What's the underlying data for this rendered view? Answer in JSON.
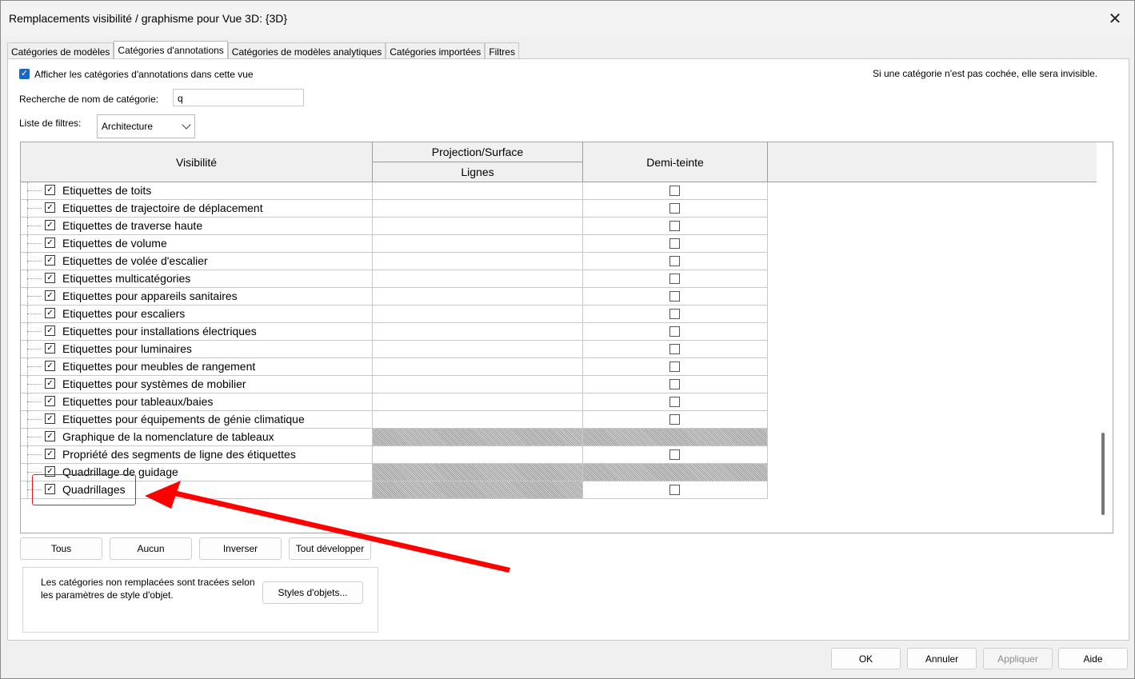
{
  "dialog": {
    "title": "Remplacements visibilité / graphisme pour Vue 3D: {3D}",
    "close_glyph": "✕"
  },
  "tabs": [
    {
      "label": "Catégories de modèles"
    },
    {
      "label": "Catégories d'annotations"
    },
    {
      "label": "Catégories de modèles analytiques"
    },
    {
      "label": "Catégories importées"
    },
    {
      "label": "Filtres"
    }
  ],
  "panel": {
    "show_categories_label": "Afficher les catégories d'annotations dans cette vue",
    "show_categories_checked": true,
    "invisible_hint": "Si une catégorie n'est pas cochée, elle sera invisible.",
    "search_label": "Recherche de nom de catégorie:",
    "search_value": "q",
    "filter_list_label": "Liste de filtres:",
    "filter_list_value": "Architecture"
  },
  "grid": {
    "col_visibility": "Visibilité",
    "col_projection": "Projection/Surface",
    "col_lines": "Lignes",
    "col_halftone": "Demi-teinte",
    "rows": [
      {
        "label": "Etiquettes de toits",
        "checked": true,
        "lines_hatched": false,
        "halftone": "checkbox"
      },
      {
        "label": "Etiquettes de trajectoire de déplacement",
        "checked": true,
        "lines_hatched": false,
        "halftone": "checkbox"
      },
      {
        "label": "Etiquettes de traverse haute",
        "checked": true,
        "lines_hatched": false,
        "halftone": "checkbox"
      },
      {
        "label": "Etiquettes de volume",
        "checked": true,
        "lines_hatched": false,
        "halftone": "checkbox"
      },
      {
        "label": "Etiquettes de volée d'escalier",
        "checked": true,
        "lines_hatched": false,
        "halftone": "checkbox"
      },
      {
        "label": "Etiquettes multicatégories",
        "checked": true,
        "lines_hatched": false,
        "halftone": "checkbox"
      },
      {
        "label": "Etiquettes pour appareils sanitaires",
        "checked": true,
        "lines_hatched": false,
        "halftone": "checkbox"
      },
      {
        "label": "Etiquettes pour escaliers",
        "checked": true,
        "lines_hatched": false,
        "halftone": "checkbox"
      },
      {
        "label": "Etiquettes pour installations électriques",
        "checked": true,
        "lines_hatched": false,
        "halftone": "checkbox"
      },
      {
        "label": "Etiquettes pour luminaires",
        "checked": true,
        "lines_hatched": false,
        "halftone": "checkbox"
      },
      {
        "label": "Etiquettes pour meubles de rangement",
        "checked": true,
        "lines_hatched": false,
        "halftone": "checkbox"
      },
      {
        "label": "Etiquettes pour systèmes de mobilier",
        "checked": true,
        "lines_hatched": false,
        "halftone": "checkbox"
      },
      {
        "label": "Etiquettes pour tableaux/baies",
        "checked": true,
        "lines_hatched": false,
        "halftone": "checkbox"
      },
      {
        "label": "Etiquettes pour équipements de génie climatique",
        "checked": true,
        "lines_hatched": false,
        "halftone": "checkbox"
      },
      {
        "label": "Graphique de la nomenclature de tableaux",
        "checked": true,
        "lines_hatched": true,
        "halftone": "hatched"
      },
      {
        "label": "Propriété des segments de ligne des étiquettes",
        "checked": true,
        "lines_hatched": false,
        "halftone": "checkbox"
      },
      {
        "label": "Quadrillage de guidage",
        "checked": true,
        "lines_hatched": true,
        "halftone": "hatched"
      },
      {
        "label": "Quadrillages",
        "checked": true,
        "lines_hatched": true,
        "halftone": "checkbox"
      }
    ]
  },
  "buttons": {
    "all": "Tous",
    "none": "Aucun",
    "invert": "Inverser",
    "expand_all": "Tout développer",
    "object_styles": "Styles d'objets...",
    "ok": "OK",
    "cancel": "Annuler",
    "apply": "Appliquer",
    "help": "Aide"
  },
  "info": {
    "text": "Les catégories non remplacées sont tracées selon les paramètres de style d'objet."
  },
  "annotation": {
    "highlight_color": "#e01b1b",
    "arrow_color": "#ff0000"
  }
}
